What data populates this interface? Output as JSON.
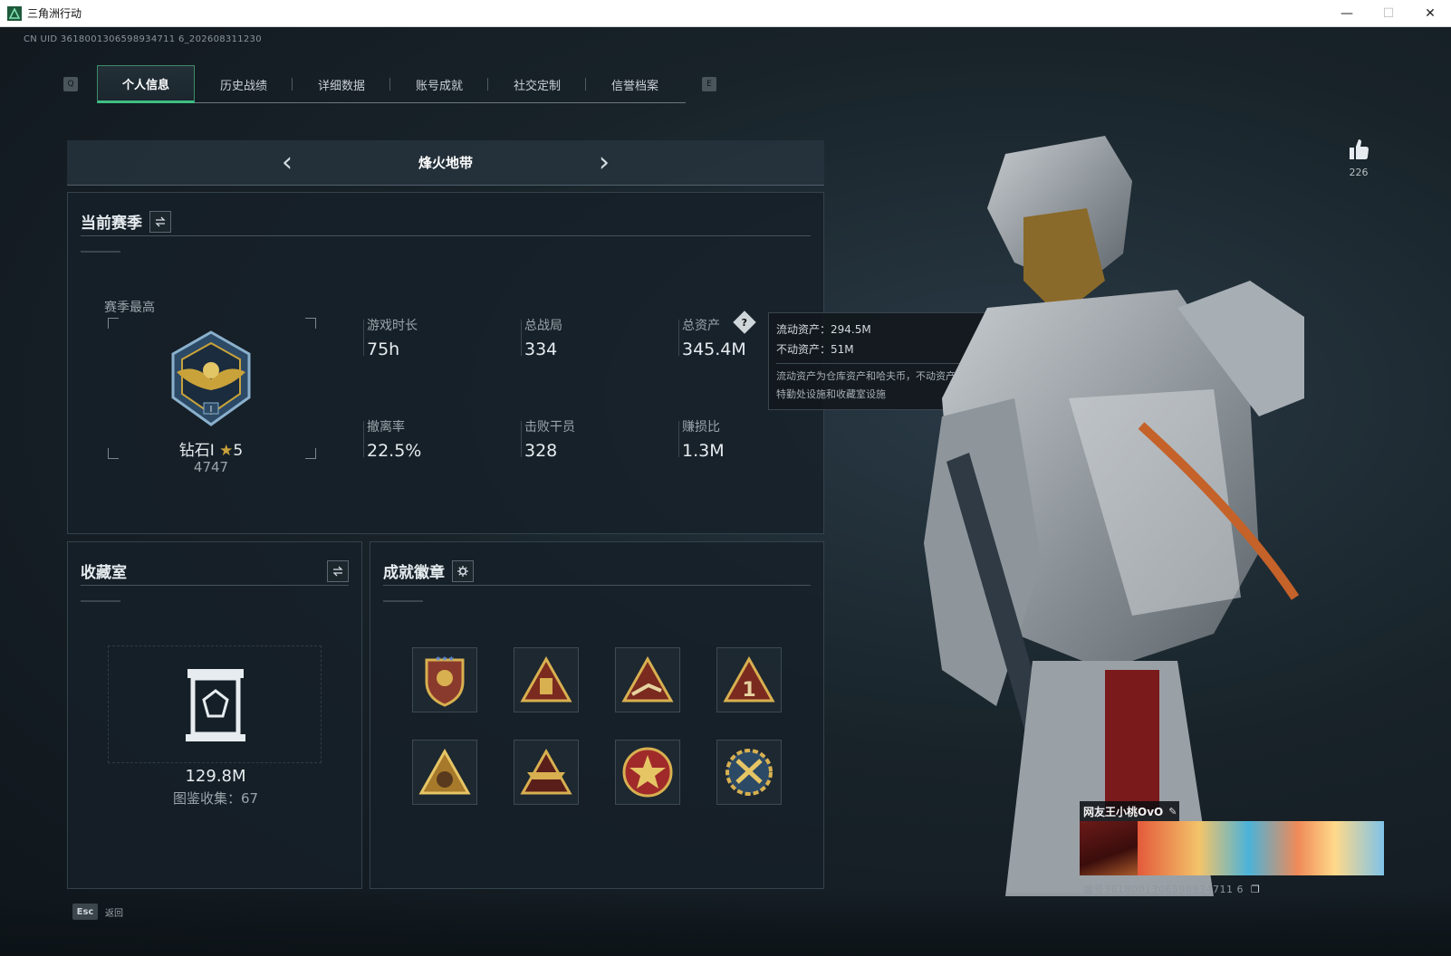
{
  "window": {
    "title": "三角洲行动",
    "minimize": "—",
    "maximize": "☐",
    "close": "✕"
  },
  "uid_line": "CN UID 3618001306598934711 6_202608311230",
  "tabs": {
    "key_left": "Q",
    "key_right": "E",
    "items": [
      {
        "label": "个人信息"
      },
      {
        "label": "历史战绩"
      },
      {
        "label": "详细数据"
      },
      {
        "label": "账号成就"
      },
      {
        "label": "社交定制"
      },
      {
        "label": "信誉档案"
      }
    ]
  },
  "mode": {
    "title": "烽火地带"
  },
  "season": {
    "title": "当前赛季",
    "best_label": "赛季最高",
    "rank": "钻石I",
    "stars": "5",
    "score": "4747",
    "stats": [
      {
        "label": "游戏时长",
        "value": "75h"
      },
      {
        "label": "总战局",
        "value": "334"
      },
      {
        "label": "总资产",
        "value": "345.4M"
      },
      {
        "label": "撤离率",
        "value": "22.5%"
      },
      {
        "label": "击败干员",
        "value": "328"
      },
      {
        "label": "赚损比",
        "value": "1.3M"
      }
    ]
  },
  "tooltip": {
    "liquid": "流动资产：294.5M",
    "fixed": "不动资产：51M",
    "desc_1": "流动资产为仓库资产和哈夫币，不动资产为",
    "desc_2": "特勤处设施和收藏室设施"
  },
  "collection": {
    "title": "收藏室",
    "value": "129.8M",
    "codex": "图鉴收集：67"
  },
  "badges": {
    "title": "成就徽章",
    "items": [
      {
        "name": "shield-badge"
      },
      {
        "name": "triangle-badge-bars"
      },
      {
        "name": "triangle-badge-prone"
      },
      {
        "name": "triangle-badge-1"
      },
      {
        "name": "triangle-badge-emblem"
      },
      {
        "name": "triangle-badge-wings"
      },
      {
        "name": "star-badge"
      },
      {
        "name": "gear-shield-badge"
      }
    ]
  },
  "likes": {
    "count": "226"
  },
  "namecard": {
    "name": "网友王小桃OvO",
    "id": "编号3618001306598934711 6"
  },
  "footer": {
    "esc_key": "Esc",
    "back_label": "返回"
  },
  "colors": {
    "accent_green": "#3fbf83",
    "gold": "#c9a23a"
  }
}
